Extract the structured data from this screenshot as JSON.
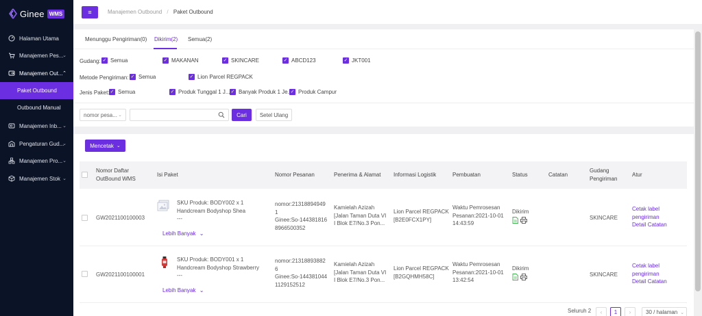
{
  "app": {
    "name": "Ginee",
    "badge": "WMS"
  },
  "sidebar": {
    "items": [
      {
        "label": "Halaman Utama",
        "icon": "dashboard-icon"
      },
      {
        "label": "Manajemen Pes...",
        "icon": "cart-icon"
      },
      {
        "label": "Manajemen Out...",
        "icon": "outbound-icon"
      },
      {
        "label": "Manajemen Inb...",
        "icon": "inbound-icon"
      },
      {
        "label": "Pengaturan Gud...",
        "icon": "warehouse-icon"
      },
      {
        "label": "Manajemen Pro...",
        "icon": "product-icon"
      },
      {
        "label": "Manajemen Stok",
        "icon": "stock-icon"
      }
    ],
    "sub_items": [
      {
        "label": "Paket Outbound",
        "active": true
      },
      {
        "label": "Outbound Manual",
        "active": false
      }
    ]
  },
  "breadcrumb": {
    "parent": "Manajemen Outbound",
    "separator": "/",
    "current": "Paket Outbound"
  },
  "tabs": [
    {
      "label": "Menunggu Pengiriman(0)"
    },
    {
      "label": "Dikirim(2)"
    },
    {
      "label": "Semua(2)"
    }
  ],
  "filters": {
    "gudang": {
      "label": "Gudang:",
      "options": [
        "Semua",
        "MAKANAN",
        "SKINCARE",
        "ABCD123",
        "JKT001"
      ]
    },
    "metode": {
      "label": "Metode Pengiriman:",
      "options": [
        "Semua",
        "Lion Parcel REGPACK"
      ]
    },
    "jenis": {
      "label": "Jenis Paket:",
      "options": [
        "Semua",
        "Produk Tunggal 1 J...",
        "Banyak Produk 1 Je...",
        "Produk Campur"
      ]
    }
  },
  "search": {
    "select_value": "nomor pesa...",
    "search_label": "Cari",
    "reset_label": "Setel Ulang"
  },
  "print_button": "Mencetak",
  "table": {
    "headers": {
      "list_no": "Nomor Daftar",
      "list_no_2": "OutBound WMS",
      "package": "Isi Paket",
      "order_no": "Nomor Pesanan",
      "recipient": "Penerima & Alamat",
      "logistics": "Informasi Logistik",
      "created": "Pembuatan",
      "status": "Status",
      "notes": "Catatan",
      "warehouse": "Gudang",
      "warehouse_2": "Pengiriman",
      "action": "Atur"
    },
    "rows": [
      {
        "list_no": "GW2021100100003",
        "sku_1": "SKU Produk:  BODY002 x 1",
        "sku_2": "Handcream Bodyshop Shea",
        "sku_3": "---",
        "more": "Lebih Banyak",
        "order_1": "nomor:21318894949",
        "order_2": "1",
        "order_3": "Ginee:So-144381816",
        "order_4": "8966500352",
        "addr_1": "Kamielah Azizah",
        "addr_2": "[Jalan Taman Duta VI",
        "addr_3": "I Blok E7/No.3 Pon...",
        "log_1": "Lion Parcel REGPACK",
        "log_2": "[B2E0FCX1PY]",
        "time_1": "Waktu Pemrosesan",
        "time_2": "Pesanan:2021-10-01",
        "time_3": "14:43:59",
        "status": "Dikirim",
        "warehouse": "SKINCARE",
        "act_1": "Cetak label",
        "act_2": "pengiriman",
        "act_3": "Detail",
        "act_4": "Catatan"
      },
      {
        "list_no": "GW2021100100001",
        "sku_1": "SKU Produk:  BODY001 x 1",
        "sku_2": "Handcream Bodyshop Strawberry",
        "sku_3": "---",
        "more": "Lebih Banyak",
        "order_1": "nomor:21318893882",
        "order_2": "6",
        "order_3": "Ginee:So-144381044",
        "order_4": "1129152512",
        "addr_1": "Kamielah Azizah",
        "addr_2": "[Jalan Taman Duta VI",
        "addr_3": "I Blok E7/No.3 Pon...",
        "log_1": "Lion Parcel REGPACK",
        "log_2": "[B2GQHMH58C]",
        "time_1": "Waktu Pemrosesan",
        "time_2": "Pesanan:2021-10-01",
        "time_3": "13:42:54",
        "status": "Dikirim",
        "warehouse": "SKINCARE",
        "act_1": "Cetak label",
        "act_2": "pengiriman",
        "act_3": "Detail",
        "act_4": "Catatan"
      }
    ]
  },
  "pagination": {
    "total": "Seluruh 2",
    "current_page": "1",
    "page_size": "30 / halaman"
  },
  "colors": {
    "accent": "#6b2ee0",
    "sidebar_bg": "#0b1426"
  }
}
